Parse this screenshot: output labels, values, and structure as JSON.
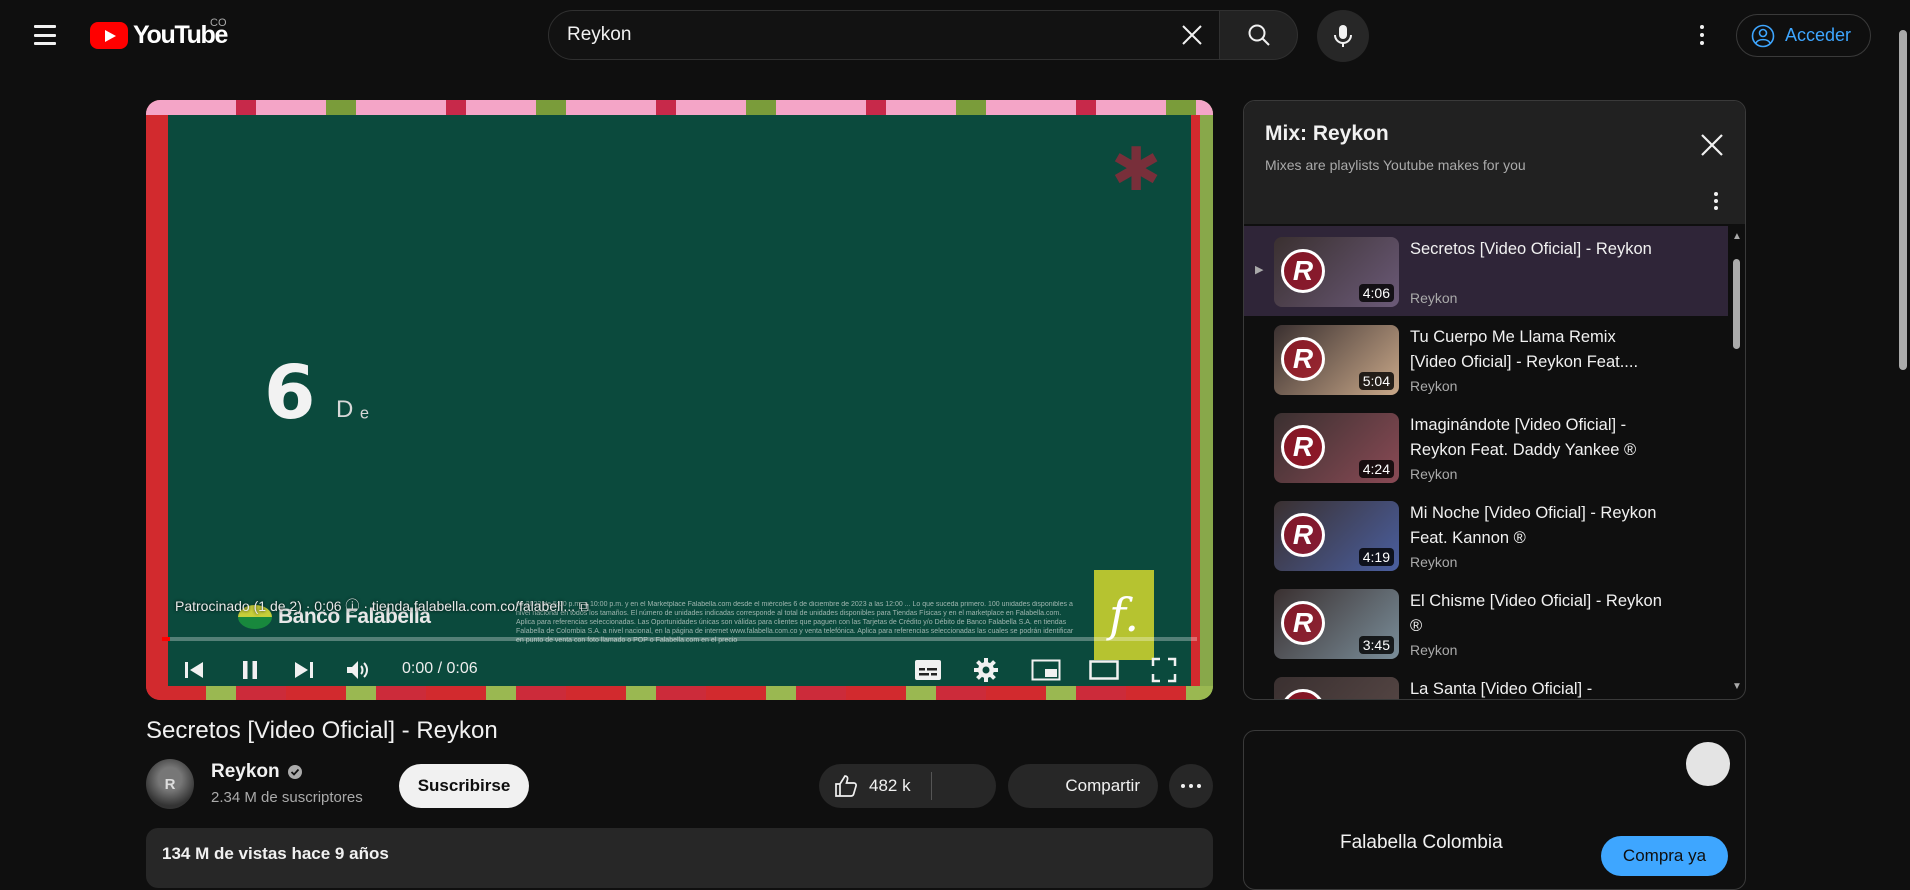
{
  "header": {
    "logo_text": "YouTube",
    "country_code": "CO",
    "search_value": "Reykon",
    "signin_label": "Acceder"
  },
  "player": {
    "sponsor_text": "Patrocinado (1 de 2) · 0:06 ⓘ · tienda.falabella.com.co/falabell... ⧉",
    "ad_big_number": "6",
    "ad_small_text": "D ₑ",
    "ad_brand": "Banco Falabella",
    "ad_brand_mark": "f.",
    "fine_print": "de 2023 de 5:00 p.m. a 10:00 p.m. y en el Marketplace Falabella.com desde el miércoles 6 de diciembre de 2023 a las 12:00 ... Lo que suceda primero. 100 unidades disponibles a nivel nacional en todos los tamaños. El número de unidades indicadas corresponde al total de unidades disponibles para Tiendas Físicas y en el marketplace en Falabella.com. Aplica para referencias seleccionadas. Las Oportunidades únicas son válidas para clientes que paguen con las Tarjetas de Crédito y/o Débito de Banco Falabella S.A. en tiendas Falabella de Colombia S.A. a nivel nacional, en la página de internet www.falabella.com.co y venta telefónica. Aplica para referencias seleccionadas las cuales se podrán identificar en punto de venta con foto llamado o POP o Falabella.com en el precio",
    "time": "0:00 / 0:06",
    "progress": 0.008
  },
  "video": {
    "title": "Secretos [Video Oficial] - Reykon",
    "channel_name": "Reykon",
    "avatar_text": "R",
    "subscribers": "2.34 M de suscriptores",
    "subscribe_label": "Suscribirse",
    "likes": "482 k",
    "share_label": "Compartir",
    "description_stats": "134 M de vistas  hace 9 años"
  },
  "mix": {
    "title": "Mix: Reykon",
    "subtitle": "Mixes are playlists Youtube makes for you",
    "items": [
      {
        "title": "Secretos [Video Oficial] - Reykon",
        "channel": "Reykon",
        "duration": "4:06",
        "active": true,
        "thumb_color": "#6b5a78"
      },
      {
        "title": "Tu Cuerpo Me Llama Remix [Video Oficial] - Reykon Feat....",
        "channel": "Reykon",
        "duration": "5:04",
        "active": false,
        "thumb_color": "#c9a889"
      },
      {
        "title": "Imaginándote [Video Oficial] - Reykon Feat. Daddy Yankee ®",
        "channel": "Reykon",
        "duration": "4:24",
        "active": false,
        "thumb_color": "#8a4a55"
      },
      {
        "title": "Mi Noche [Video Oficial] - Reykon Feat. Kannon ®",
        "channel": "Reykon",
        "duration": "4:19",
        "active": false,
        "thumb_color": "#4a5fa0"
      },
      {
        "title": "El Chisme [Video Oficial] - Reykon ®",
        "channel": "Reykon",
        "duration": "3:45",
        "active": false,
        "thumb_color": "#7a8e9a"
      },
      {
        "title": "La Santa [Video Oficial] -",
        "channel": "",
        "duration": "",
        "active": false,
        "thumb_color": "#5a4a48"
      }
    ]
  },
  "ad_card": {
    "advertiser": "Falabella Colombia",
    "cta": "Compra ya"
  },
  "colors": {
    "accent_blue": "#3ea6ff",
    "brand_red": "#ff0000",
    "active_row": "#2f2538"
  }
}
